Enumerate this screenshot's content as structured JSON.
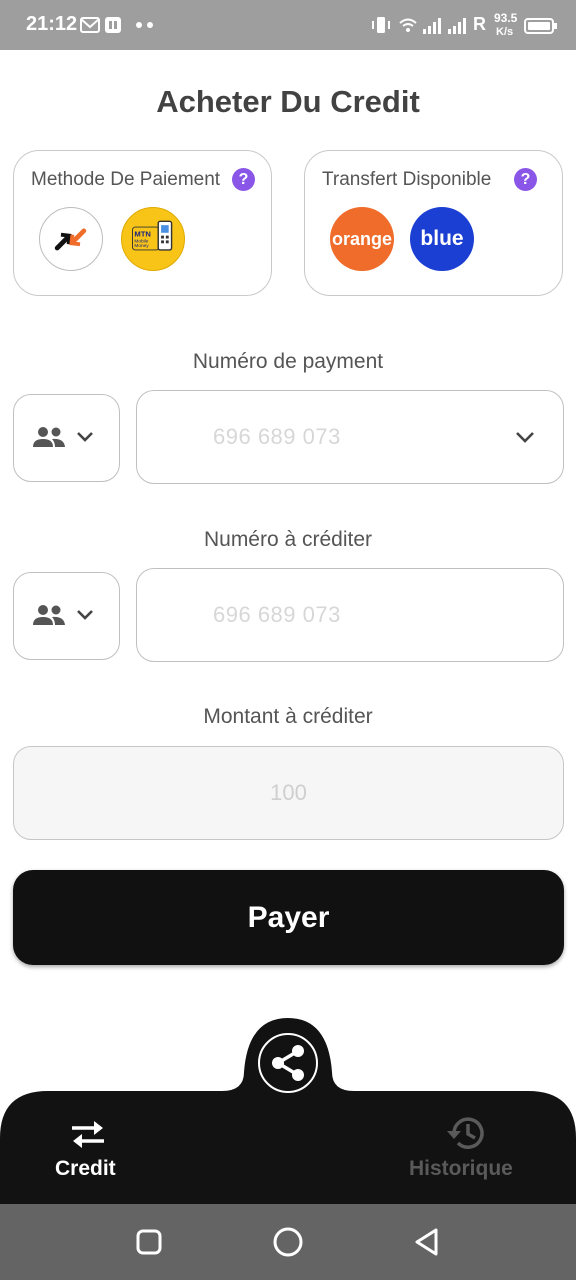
{
  "status_bar": {
    "time": "21:12",
    "network_label": "R",
    "speed_value": "93.5",
    "speed_unit": "K/s"
  },
  "page": {
    "title": "Acheter Du Credit"
  },
  "payment_methods": {
    "title": "Methode De Paiement",
    "help": "?",
    "items": [
      "orange-money-logo",
      "mtn-mobile-money-logo"
    ],
    "mtn_logo_lines": [
      "MTN",
      "Mobile",
      "Money"
    ]
  },
  "available_transfers": {
    "title": "Transfert Disponible",
    "help": "?",
    "items": [
      {
        "label": "orange",
        "color": "#ef6c2a"
      },
      {
        "label": "blue",
        "color": "#1c3fd3"
      }
    ]
  },
  "payment_number": {
    "label": "Numéro de payment",
    "placeholder": "696 689 073"
  },
  "credit_number": {
    "label": "Numéro à créditer",
    "placeholder": "696 689 073"
  },
  "amount": {
    "label": "Montant à créditer",
    "placeholder": "100"
  },
  "pay_button": {
    "label": "Payer"
  },
  "bottom_nav": {
    "items": [
      {
        "label": "Credit",
        "icon": "transfer-arrows-icon",
        "active": true
      },
      {
        "label": "Historique",
        "icon": "history-icon",
        "active": false
      }
    ],
    "fab_icon": "share-icon"
  },
  "colors": {
    "accent": "#111111",
    "help_badge": "#8a56e8",
    "inactive_nav": "#5a5a5a"
  }
}
